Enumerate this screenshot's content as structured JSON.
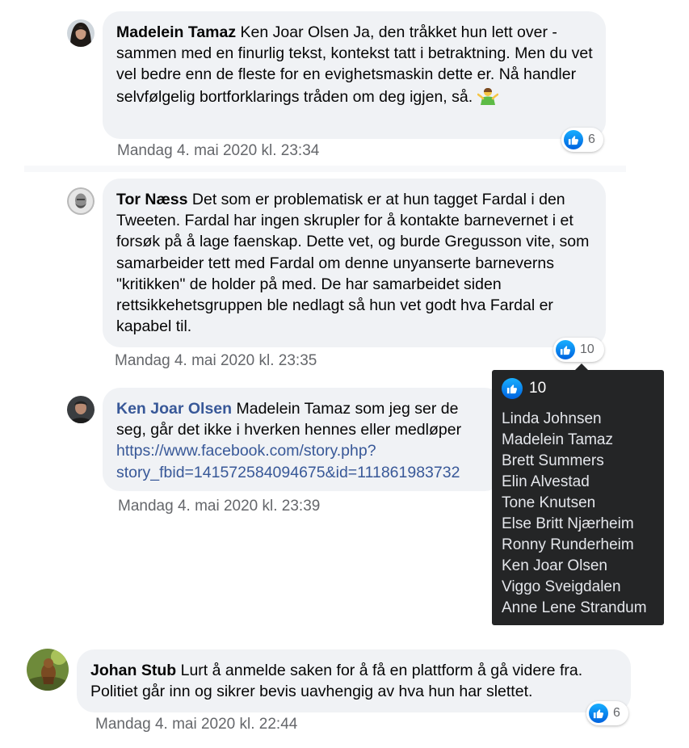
{
  "comments": [
    {
      "author": "Madelein Tamaz",
      "text": "Ken Joar Olsen Ja, den tråkket hun lett over - sammen med en finurlig tekst, kontekst tatt i betraktning. Men du vet vel bedre enn de fleste for en evighetsmaskin dette er. Nå handler selvfølgelig bortforklarings tråden om deg igjen, så.",
      "emoji": "man-shrugging-emoji",
      "reaction_count": "6",
      "timestamp": "Mandag 4. mai 2020 kl. 23:34"
    },
    {
      "author": "Tor Næss",
      "text": "Det som er problematisk er at hun tagget Fardal i den Tweeten. Fardal har ingen skrupler for å kontakte barnevernet i et forsøk på å lage faenskap. Dette vet, og burde Gregusson vite, som samarbeider tett med Fardal om denne unyanserte barneverns \"kritikken\" de holder på med. De har samarbeidet siden rettsikkehetsgruppen ble nedlagt så hun vet godt hva Fardal er kapabel til.",
      "reaction_count": "10",
      "timestamp": "Mandag 4. mai 2020 kl. 23:35"
    },
    {
      "author": "Ken Joar Olsen",
      "text_line1": "Madelein Tamaz som jeg ser de",
      "text_line2": "seg, går det ikke i hverken hennes eller medløper",
      "link_line1": "https://www.facebook.com/story.php?",
      "link_line2": "story_fbid=141572584094675&id=111861983732",
      "timestamp": "Mandag 4. mai 2020 kl. 23:39"
    },
    {
      "author": "Johan Stub",
      "text": "Lurt å anmelde saken for å få en plattform å gå videre fra. Politiet går inn og sikrer bevis uavhengig av hva hun har slettet.",
      "reaction_count": "6",
      "timestamp": "Mandag 4. mai 2020 kl. 22:44"
    }
  ],
  "tooltip": {
    "count": "10",
    "names": [
      "Linda Johnsen",
      "Madelein Tamaz",
      "Brett Summers",
      "Elin Alvestad",
      "Tone Knutsen",
      "Else Britt Njærheim",
      "Ronny Runderheim",
      "Ken Joar Olsen",
      "Viggo Sveigdalen",
      "Anne Lene Strandum"
    ]
  },
  "icons": {
    "reaction": "like-thumbs-up-icon",
    "emoji": "man-shrugging-emoji"
  },
  "colors": {
    "bubble": "#f0f2f5",
    "link": "#385898",
    "timestamp": "#65676b",
    "like_blue": "#1877f2",
    "tooltip_bg": "#242526"
  }
}
